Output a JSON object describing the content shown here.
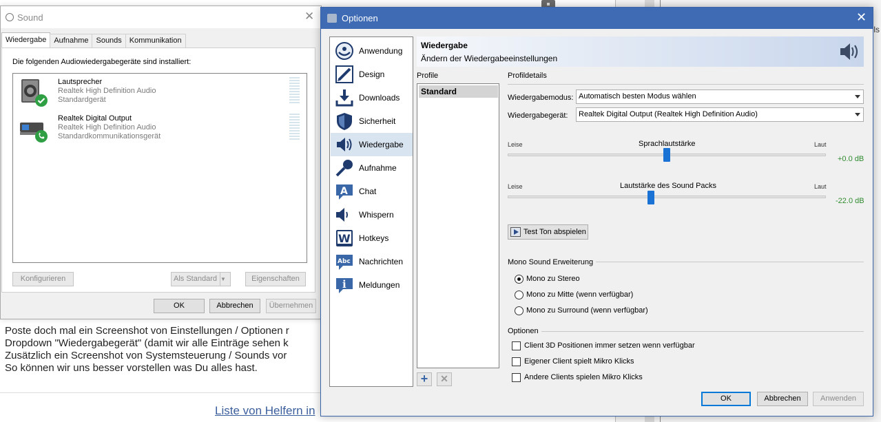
{
  "background": {
    "lines": [
      "Poste doch mal ein Screenshot von Einstellungen / Optionen r",
      "Dropdown \"Wiedergabegerät\" (damit wir alle Einträge sehen k",
      "Zusätzlich ein Screenshot von Systemsteuerung / Sounds vor",
      "So können wir uns besser vorstellen was Du alles hast."
    ],
    "link": "Liste von Helfern in",
    "right_text": "ls"
  },
  "sound": {
    "title": "Sound",
    "tabs": [
      "Wiedergabe",
      "Aufnahme",
      "Sounds",
      "Kommunikation"
    ],
    "description": "Die folgenden Audiowiedergabegeräte sind installiert:",
    "devices": [
      {
        "name": "Lautsprecher",
        "driver": "Realtek High Definition Audio",
        "status": "Standardgerät",
        "badge": "checkmark-icon"
      },
      {
        "name": "Realtek Digital Output",
        "driver": "Realtek High Definition Audio",
        "status": "Standardkommunikationsgerät",
        "badge": "phone-icon"
      }
    ],
    "buttons": {
      "configure": "Konfigurieren",
      "set_default": "Als Standard",
      "properties": "Eigenschaften",
      "ok": "OK",
      "cancel": "Abbrechen",
      "apply": "Übernehmen"
    }
  },
  "options": {
    "title": "Optionen",
    "nav": [
      {
        "label": "Anwendung",
        "icon": "teamspeak-icon"
      },
      {
        "label": "Design",
        "icon": "design-icon"
      },
      {
        "label": "Downloads",
        "icon": "download-icon"
      },
      {
        "label": "Sicherheit",
        "icon": "shield-icon"
      },
      {
        "label": "Wiedergabe",
        "icon": "speaker-icon"
      },
      {
        "label": "Aufnahme",
        "icon": "microphone-icon"
      },
      {
        "label": "Chat",
        "icon": "chat-icon"
      },
      {
        "label": "Whispern",
        "icon": "whisper-icon"
      },
      {
        "label": "Hotkeys",
        "icon": "hotkeys-icon"
      },
      {
        "label": "Nachrichten",
        "icon": "messages-icon"
      },
      {
        "label": "Meldungen",
        "icon": "info-icon"
      }
    ],
    "selected_nav": "Wiedergabe",
    "banner": {
      "title": "Wiedergabe",
      "subtitle": "Ändern der Wiedergabeeinstellungen"
    },
    "profiles": {
      "header": "Profile",
      "items": [
        "Standard"
      ]
    },
    "details": {
      "header": "Profildetails",
      "mode_label": "Wiedergabemodus:",
      "mode_value": "Automatisch besten Modus wählen",
      "device_label": "Wiedergabegerät:",
      "device_value": "Realtek Digital Output (Realtek High Definition Audio)",
      "voice_volume": {
        "title": "Sprachlautstärke",
        "low": "Leise",
        "high": "Laut",
        "value": "+0.0 dB"
      },
      "pack_volume": {
        "title": "Lautstärke des Sound Packs",
        "low": "Leise",
        "high": "Laut",
        "value": "-22.0 dB"
      },
      "test_button": "Test Ton abspielen",
      "mono_group": "Mono Sound Erweiterung",
      "mono_options": [
        "Mono zu Stereo",
        "Mono zu Mitte (wenn verfügbar)",
        "Mono zu Surround (wenn verfügbar)"
      ],
      "mono_selected": 0,
      "options_group": "Optionen",
      "checkboxes": [
        {
          "label": "Client 3D Positionen immer setzen wenn verfügbar",
          "checked": false
        },
        {
          "label": "Eigener Client spielt Mikro Klicks",
          "checked": false
        },
        {
          "label": "Andere Clients spielen Mikro Klicks",
          "checked": false
        }
      ]
    },
    "buttons": {
      "ok": "OK",
      "cancel": "Abbrechen",
      "apply": "Anwenden"
    }
  }
}
